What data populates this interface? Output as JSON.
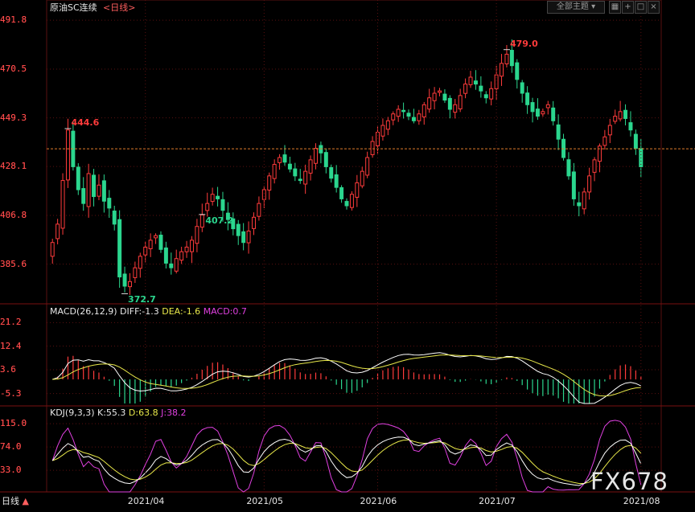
{
  "header": {
    "instrument": "原油SC连续",
    "period_label": "<日线>",
    "theme_button": "全部主题",
    "tool_icons": [
      "grid-icon",
      "plus-icon",
      "maximize-icon",
      "restore-icon",
      "close-icon"
    ]
  },
  "footer": {
    "period_tab": "日线",
    "period_arrow": "▲",
    "watermark": "FX678"
  },
  "colors": {
    "up": "#ff3b3b",
    "down": "#2bd68e",
    "dif": "#ffffff",
    "dea": "#e8e84a",
    "macd_pos": "#ff3b3b",
    "macd_neg": "#2bd68e",
    "k": "#ffffff",
    "d": "#e8e84a",
    "j": "#e040e0",
    "grid": "#5a1010",
    "last_price_line": "#e07a2a"
  },
  "chart_data": [
    {
      "type": "candlestick",
      "title": "原油SC连续<日线>",
      "y_ticks": [
        "491.8",
        "470.5",
        "449.3",
        "428.1",
        "406.8",
        "385.6"
      ],
      "ylim": [
        369,
        495
      ],
      "x_ticks": [
        "2021/04",
        "2021/05",
        "2021/06",
        "2021/07",
        "2021/08"
      ],
      "annotations": [
        {
          "text": "444.6",
          "value": 444.6,
          "kind": "high"
        },
        {
          "text": "372.7",
          "value": 372.7,
          "kind": "low"
        },
        {
          "text": "479.0",
          "value": 479.0,
          "kind": "high"
        },
        {
          "text": "407.2",
          "value": 407.2,
          "kind": "low"
        }
      ],
      "last_price": 435.8,
      "closes": [
        395,
        403,
        422,
        444,
        428,
        418,
        412,
        425,
        415,
        420,
        413,
        410,
        403,
        380,
        376,
        378,
        384,
        389,
        393,
        396,
        398,
        392,
        386,
        384,
        388,
        391,
        393,
        396,
        402,
        407,
        412,
        416,
        414,
        409,
        405,
        401,
        398,
        395,
        400,
        406,
        412,
        418,
        424,
        429,
        432,
        430,
        427,
        424,
        422,
        426,
        431,
        436,
        434,
        428,
        423,
        419,
        414,
        411,
        416,
        421,
        426,
        432,
        439,
        443,
        446,
        448,
        451,
        453,
        452,
        450,
        448,
        451,
        455,
        458,
        460,
        461,
        457,
        453,
        455,
        459,
        464,
        467,
        464,
        461,
        458,
        462,
        468,
        473,
        477,
        472,
        466,
        460,
        455,
        452,
        450,
        452,
        455,
        448,
        440,
        432,
        424,
        414,
        411,
        417,
        424,
        431,
        437,
        441,
        446,
        450,
        452,
        449,
        444,
        436,
        428
      ],
      "macd_label": "MACD(26,12,9)",
      "macd_values": {
        "DIFF": "-1.3",
        "DEA": "-1.6",
        "MACD": "0.7"
      },
      "macd_ticks": [
        "21.2",
        "12.4",
        "3.6",
        "-5.3"
      ],
      "kdj_label": "KDJ(9,3,3)",
      "kdj_values": {
        "K": "55.3",
        "D": "63.8",
        "J": "38.2"
      },
      "kdj_ticks": [
        "115.0",
        "74.0",
        "33.0"
      ]
    }
  ]
}
